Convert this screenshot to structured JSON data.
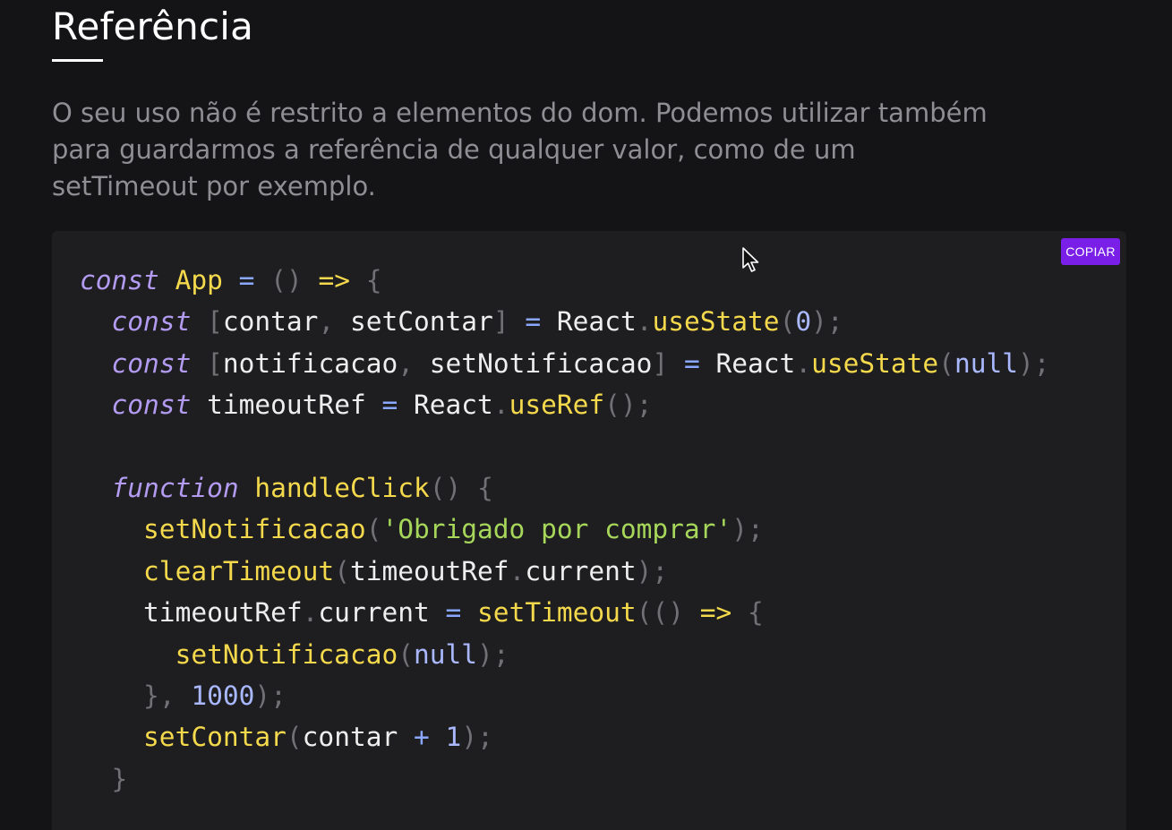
{
  "section": {
    "title": "Referência",
    "description": "O seu uso não é restrito a elementos do dom. Podemos utilizar também para guardarmos a referência de qualquer valor, como de um setTimeout por exemplo."
  },
  "code_block": {
    "copy_label": "COPIAR",
    "language": "javascript",
    "lines": [
      "const App = () => {",
      "  const [contar, setContar] = React.useState(0);",
      "  const [notificacao, setNotificacao] = React.useState(null);",
      "  const timeoutRef = React.useRef();",
      "",
      "  function handleClick() {",
      "    setNotificacao('Obrigado por comprar');",
      "    clearTimeout(timeoutRef.current);",
      "    timeoutRef.current = setTimeout(() => {",
      "      setNotificacao(null);",
      "    }, 1000);",
      "    setContar(contar + 1);",
      "  }"
    ]
  },
  "colors": {
    "background": "#141417",
    "code_background": "#1e1e20",
    "copy_button": "#7a1fe8",
    "keyword": "#b29bf0",
    "function": "#f5d94c",
    "operator": "#8aa8ff",
    "string": "#a6d65a"
  },
  "icons": {
    "cursor": "mouse-pointer-icon"
  }
}
